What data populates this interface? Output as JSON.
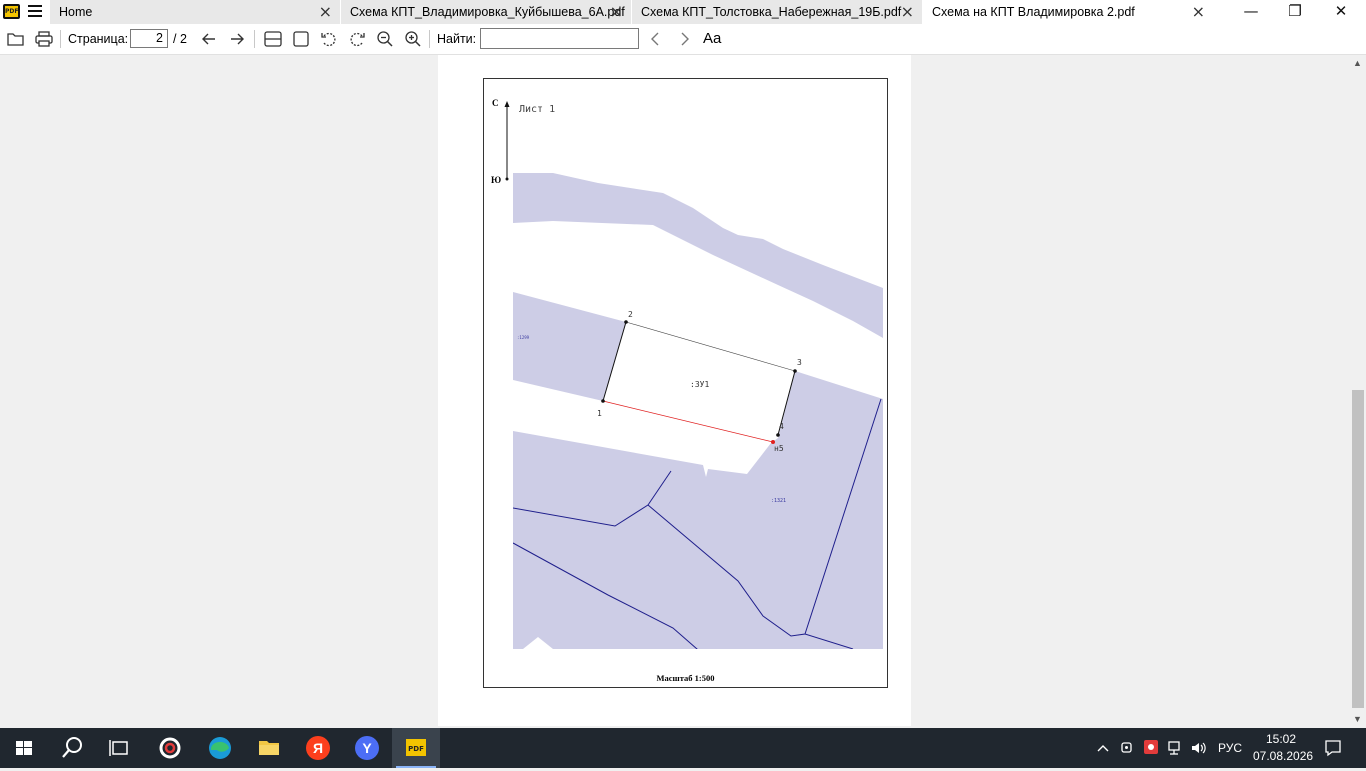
{
  "tabs": [
    {
      "label": "Home",
      "active": false
    },
    {
      "label": "Схема КПТ_Владимировка_Куйбышева_6А.pdf",
      "active": false
    },
    {
      "label": "Схема КПТ_Толстовка_Набережная_19Б.pdf",
      "active": false
    },
    {
      "label": "Схема на КПТ Владимировка 2.pdf",
      "active": true
    }
  ],
  "app_icon": {
    "label": "PDF"
  },
  "window_controls": {
    "minimize": "—",
    "restore": "❐",
    "close": "✕"
  },
  "toolbar": {
    "page_label": "Страница:",
    "page_current": "2",
    "page_total": "/ 2",
    "find_label": "Найти:",
    "find_value": "",
    "case_label": "Aa"
  },
  "document": {
    "sheet_title": "Лист 1",
    "north_label": "С",
    "south_label": "Ю",
    "scale_label": "Масштаб 1:500",
    "parcel_label": ":ЗУ1",
    "neighbor_labels": [
      ":1299",
      ":1321"
    ],
    "point_labels": [
      "1",
      "2",
      "3",
      "4",
      "н5"
    ],
    "colors": {
      "parcel_fill": "#cdcde6",
      "boundary": "#1f1f8c",
      "new_line": "#e02020"
    }
  },
  "taskbar": {
    "apps": [
      "start-icon",
      "search-icon",
      "task-view-icon",
      "ccleaner-icon",
      "edge-icon",
      "file-explorer-icon",
      "yandex-icon",
      "yandex-browser-icon",
      "pdf-reader-icon"
    ],
    "lang": "РУС",
    "time": "15:02",
    "date": "07.08.2026"
  }
}
